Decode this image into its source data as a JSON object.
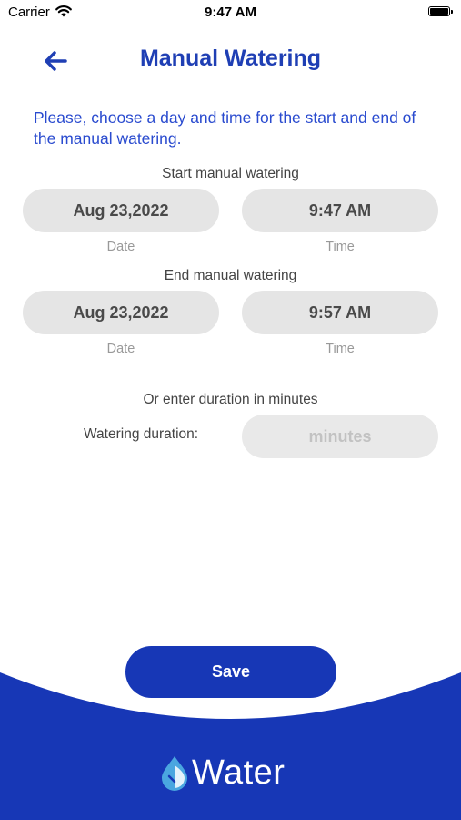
{
  "status_bar": {
    "carrier": "Carrier",
    "time": "9:47 AM"
  },
  "header": {
    "title": "Manual Watering",
    "back_icon": "arrow-left-icon"
  },
  "instructions": "Please, choose a day and time for the start and end of the manual watering.",
  "start": {
    "label": "Start manual watering",
    "date": "Aug 23,2022",
    "time": "9:47 AM",
    "date_caption": "Date",
    "time_caption": "Time"
  },
  "end": {
    "label": "End manual watering",
    "date": "Aug 23,2022",
    "time": "9:57 AM",
    "date_caption": "Date",
    "time_caption": "Time"
  },
  "duration": {
    "heading": "Or enter duration in minutes",
    "label": "Watering duration:",
    "placeholder": "minutes",
    "value": ""
  },
  "save_label": "Save",
  "logo_text": "Water",
  "colors": {
    "primary": "#1737b6",
    "title": "#1f3fb4",
    "pill": "#e5e5e5"
  }
}
